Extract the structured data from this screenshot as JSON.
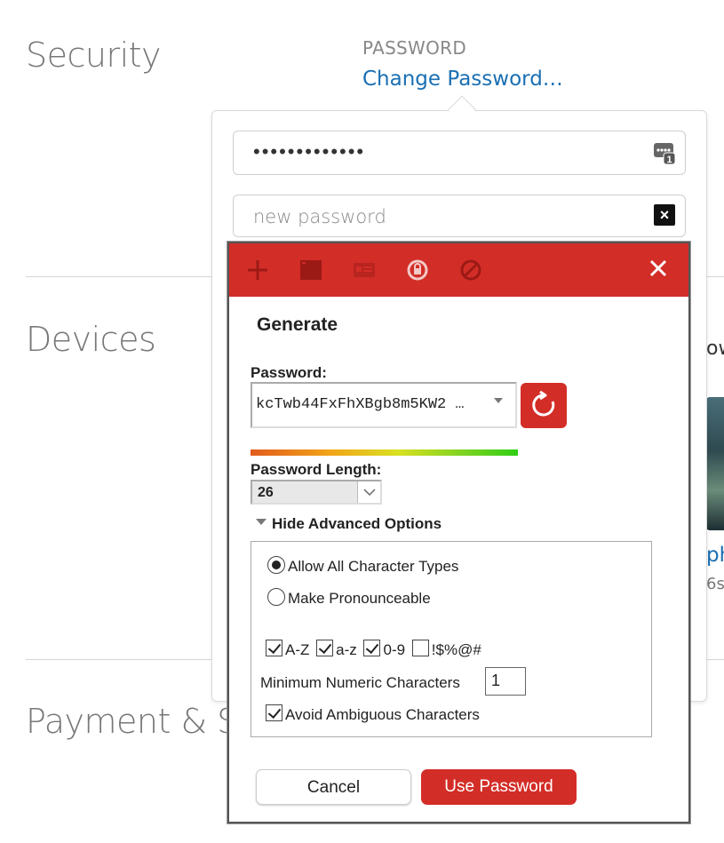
{
  "page": {
    "sections": {
      "security": "Security",
      "devices": "Devices",
      "payment": "Payment & Sh"
    },
    "password_label": "PASSWORD",
    "change_password_link": "Change Password…",
    "devices_right": {
      "partial_heading": "ow",
      "partial_link": "ph",
      "partial_sub": "6s"
    }
  },
  "change_password_popover": {
    "current_password_mask": "•••••••••••••",
    "new_password_placeholder": "new password",
    "keyboard_icon_badge": "1"
  },
  "lastpass": {
    "toolbar_icons": [
      "plus-icon",
      "site-icon",
      "card-icon",
      "lock-refresh-icon",
      "disable-icon"
    ],
    "heading": "Generate",
    "password_label": "Password:",
    "generated_password": "kcTwb44FxFhXBgb8m5KW2 …",
    "strength_fraction": 1.0,
    "length_label": "Password Length:",
    "length_value": "26",
    "advanced_toggle": "Hide Advanced Options",
    "options": {
      "allow_all": "Allow All Character Types",
      "pronounceable": "Make Pronounceable",
      "selected": "allow_all"
    },
    "charsets": [
      {
        "label": "A-Z",
        "checked": true
      },
      {
        "label": "a-z",
        "checked": true
      },
      {
        "label": "0-9",
        "checked": true
      },
      {
        "label": "!$%@#",
        "checked": false
      }
    ],
    "min_numeric_label": "Minimum Numeric Characters",
    "min_numeric_value": "1",
    "avoid_ambiguous_label": "Avoid Ambiguous Characters",
    "avoid_ambiguous_checked": true,
    "cancel_label": "Cancel",
    "use_label": "Use Password",
    "accent": "#d32d27"
  }
}
